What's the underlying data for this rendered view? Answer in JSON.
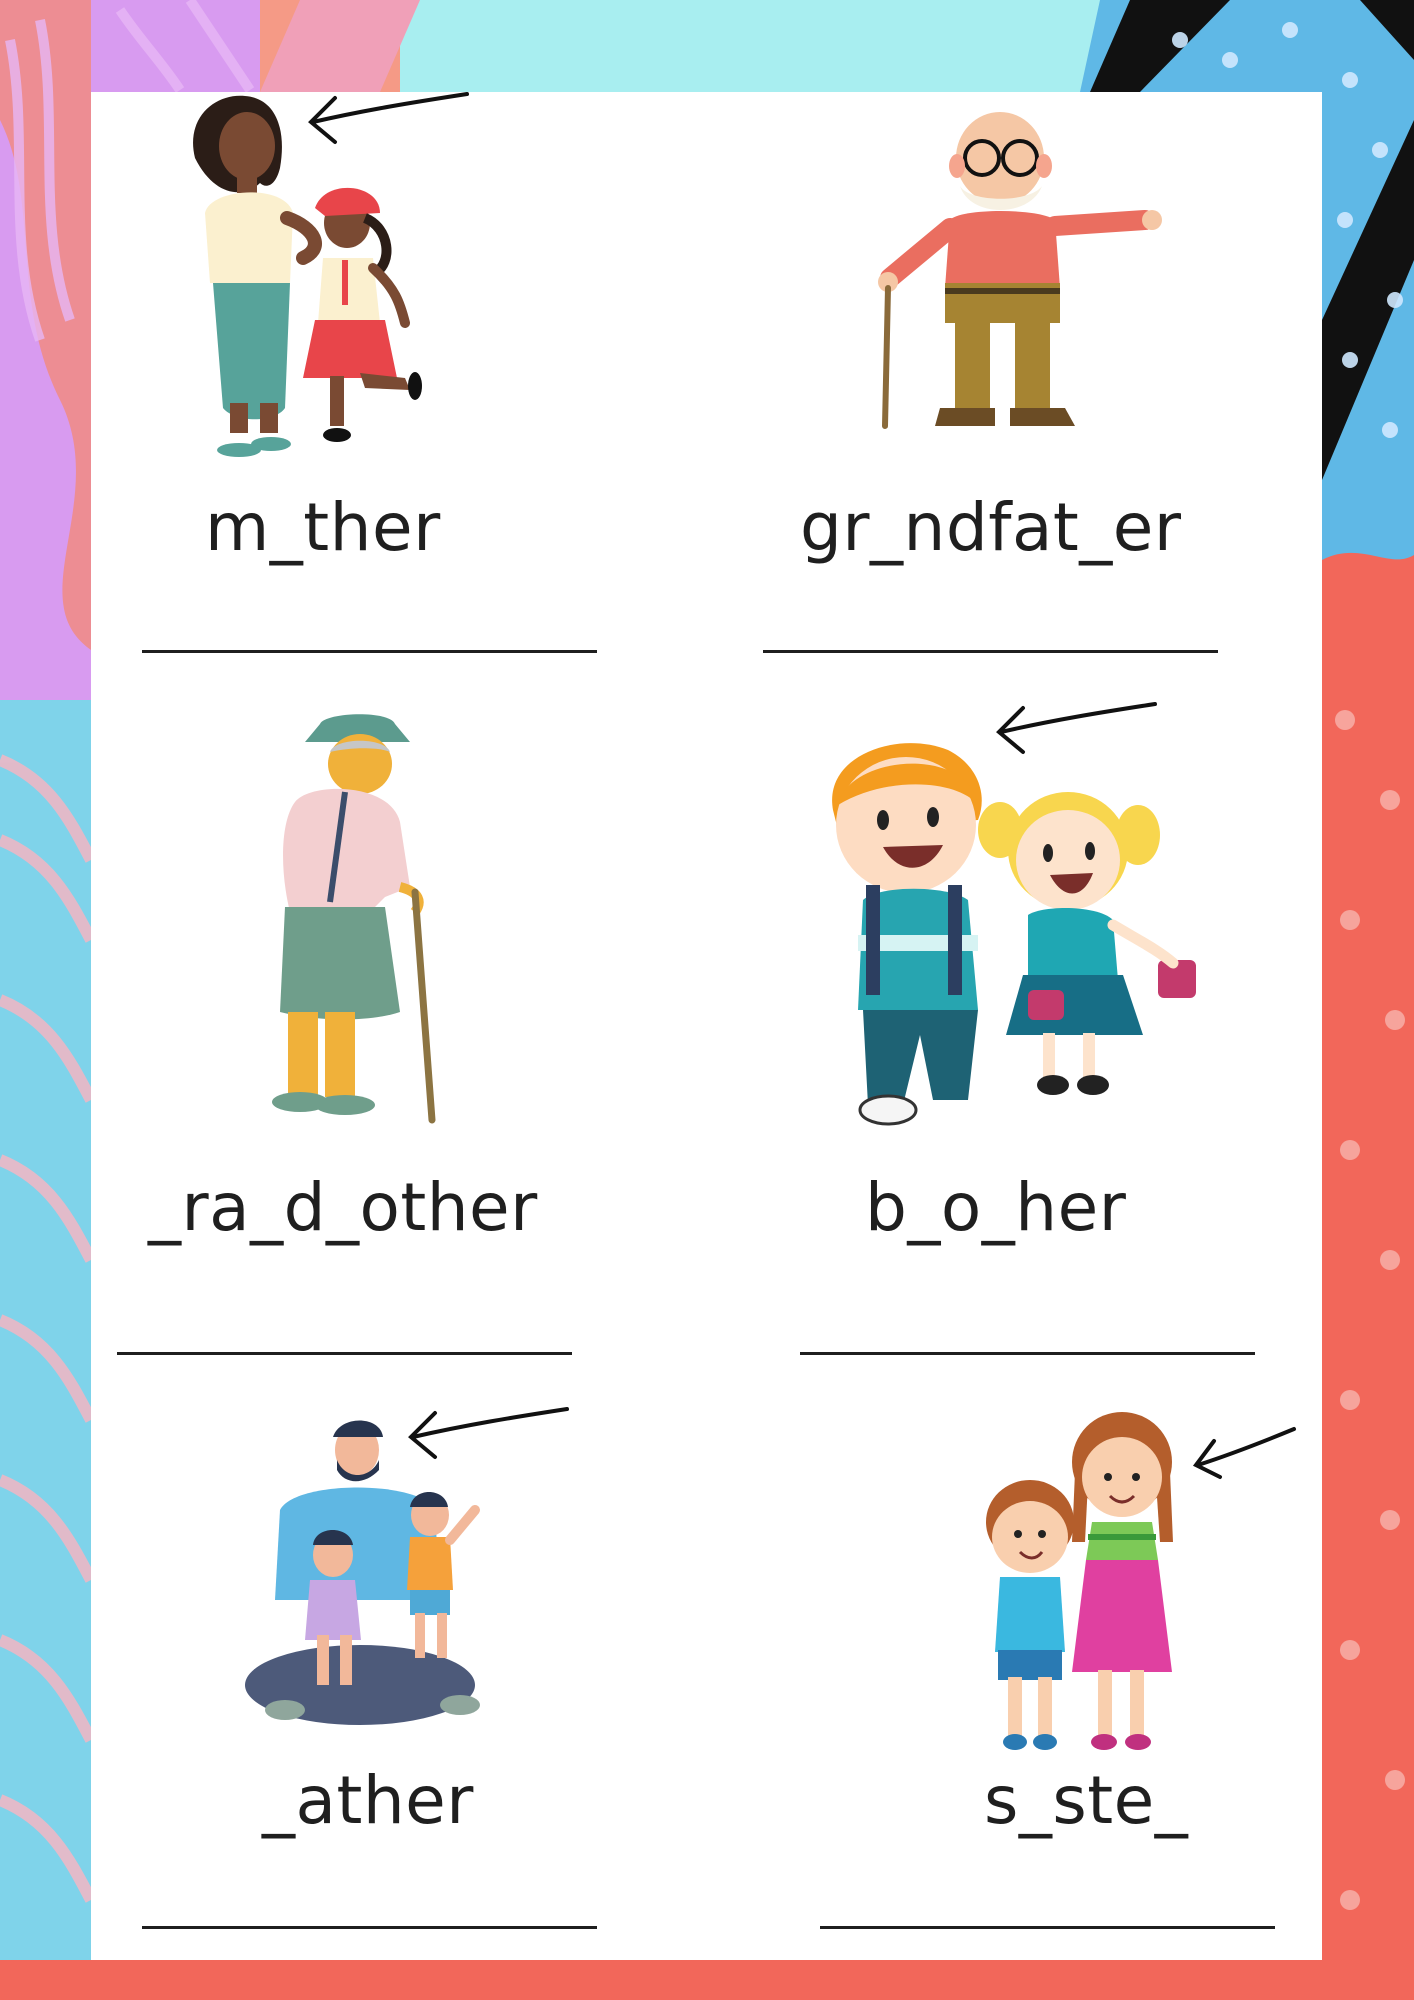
{
  "colors": {
    "coral": "#f2675a",
    "salmon": "#f59a86",
    "lilac": "#d89bf0",
    "sky": "#7fd3ea",
    "blue": "#5fb8e6",
    "black": "#111111",
    "paper": "#ffffff",
    "ink": "#1f1f1f"
  },
  "cards": [
    {
      "word": "m_ther",
      "picture": "mother-and-daughter-illustration",
      "arrow": true
    },
    {
      "word": "gr_ndfat_er",
      "picture": "grandfather-with-cane-illustration",
      "arrow": false
    },
    {
      "word": "_ra_d_other",
      "picture": "grandmother-with-cane-illustration",
      "arrow": false
    },
    {
      "word": "b_o_her",
      "picture": "brother-and-sister-walking-illustration",
      "arrow": true
    },
    {
      "word": "_ather",
      "picture": "father-with-children-illustration",
      "arrow": true
    },
    {
      "word": "s_ste_",
      "picture": "sister-and-brother-standing-illustration",
      "arrow": true
    }
  ]
}
